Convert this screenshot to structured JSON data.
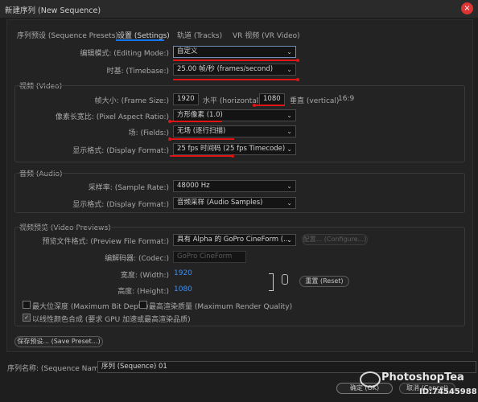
{
  "window": {
    "title": "新建序列 (New Sequence)",
    "close_icon": "×"
  },
  "tabs": [
    {
      "label": "序列预设 (Sequence Presets)"
    },
    {
      "label": "设置 (Settings)"
    },
    {
      "label": "轨道 (Tracks)"
    },
    {
      "label": "VR 视频 (VR Video)"
    }
  ],
  "general": {
    "editing_mode_label": "编辑模式: (Editing Mode:)",
    "editing_mode_value": "自定义",
    "timebase_label": "时基: (Timebase:)",
    "timebase_value": "25.00 帧/秒 (frames/second)"
  },
  "video": {
    "section_label": "视频 (Video)",
    "frame_size_label": "帧大小: (Frame Size:)",
    "frame_width": "1920",
    "horizontal_label": "水平 (horizontal)",
    "frame_height": "1080",
    "vertical_label": "垂直 (vertical)",
    "aspect": "16:9",
    "pixel_aspect_label": "像素长宽比: (Pixel Aspect Ratio:)",
    "pixel_aspect_value": "方形像素 (1.0)",
    "fields_label": "场: (Fields:)",
    "fields_value": "无场 (逐行扫描)",
    "display_format_label": "显示格式: (Display Format:)",
    "display_format_value": "25 fps 时间码 (25 fps Timecode)"
  },
  "audio": {
    "section_label": "音频 (Audio)",
    "sample_rate_label": "采样率: (Sample Rate:)",
    "sample_rate_value": "48000 Hz",
    "display_format_label": "显示格式: (Display Format:)",
    "display_format_value": "音频采样 (Audio Samples)"
  },
  "previews": {
    "section_label": "视频预览 (Video Previews)",
    "preview_format_label": "预览文件格式: (Preview File Format:)",
    "preview_format_value": "具有 Alpha 的 GoPro CineForm (...",
    "configure_label": "配置... (Configure...)",
    "codec_label": "编解码器: (Codec:)",
    "codec_value": "GoPro CineForm",
    "width_label": "宽度: (Width:)",
    "width_value": "1920",
    "height_label": "高度: (Height:)",
    "height_value": "1080",
    "reset_label": "重置 (Reset)",
    "link_icon": "link-icon"
  },
  "options": {
    "max_bit_depth": "最大位深度 (Maximum Bit Depth)",
    "max_render_quality": "最高渲染质量 (Maximum Render Quality)",
    "linear_color": "以线性颜色合成 (要求 GPU 加速或最高渲染品质)"
  },
  "save_preset_label": "保存预设... (Save Preset...)",
  "sequence_name_label": "序列名称: (Sequence Name:)",
  "sequence_name_value": "序列 (Sequence) 01",
  "ok_label": "确定 (OK)",
  "cancel_label": "取消 (Cancel)",
  "watermark": {
    "brand": "PhotoshopTea",
    "id": "ID:74545988"
  },
  "colors": {
    "accent": "#1473e6",
    "annotation_red": "#e01414",
    "link_blue": "#3b8ff3"
  }
}
